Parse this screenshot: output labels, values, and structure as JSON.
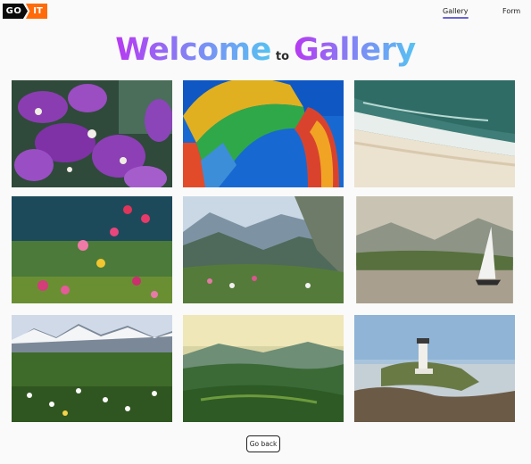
{
  "logo": {
    "part1": "GO",
    "part2": "IT"
  },
  "nav": {
    "gallery": "Gallery",
    "form": "Form"
  },
  "title": {
    "word1": "Welcome",
    "word2": "to",
    "word3": "Gallery"
  },
  "gallery": {
    "images": [
      {
        "subject": "purple orchids"
      },
      {
        "subject": "colorful container arch"
      },
      {
        "subject": "aerial beach waves"
      },
      {
        "subject": "wildflowers meadow"
      },
      {
        "subject": "mountain valley with flowers"
      },
      {
        "subject": "sailboat on lake"
      },
      {
        "subject": "daisy field with mountains"
      },
      {
        "subject": "green hills landscape"
      },
      {
        "subject": "lighthouse on rocky coast"
      }
    ]
  },
  "footer": {
    "back_label": "Go back"
  },
  "colors": {
    "accent_orange": "#ff6b0a",
    "nav_underline": "#6a63d6",
    "title_gradient_start": "#b739f2",
    "title_gradient_end": "#56c2f2"
  }
}
